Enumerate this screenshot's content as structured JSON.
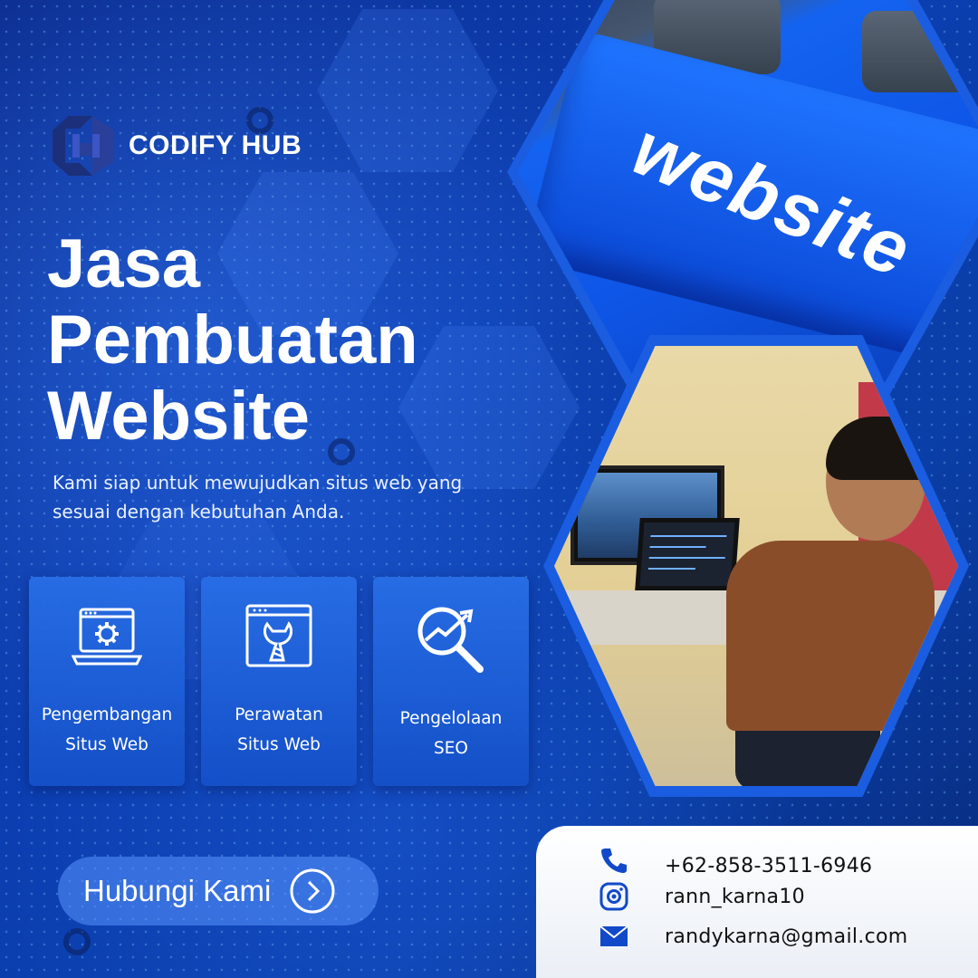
{
  "brand": {
    "name": "CODIFY HUB"
  },
  "headline": {
    "line1": "Jasa",
    "line2": "Pembuatan",
    "line3": "Website"
  },
  "subtitle": "Kami siap untuk mewujudkan situs web yang sesuai dengan kebutuhan Anda.",
  "services": [
    {
      "label": "Pengembangan\nSitus Web",
      "icon": "web-development-icon"
    },
    {
      "label": "Perawatan\nSitus Web",
      "icon": "website-maintenance-icon"
    },
    {
      "label": "Pengelolaan\nSEO",
      "icon": "seo-search-icon"
    }
  ],
  "cta": {
    "label": "Hubungi Kami",
    "icon": "chevron-right-circle-icon"
  },
  "photos": {
    "keyboard_key_text": "website"
  },
  "contact": {
    "phone": "+62-858-3511-6946",
    "instagram": "rann_karna10",
    "email": "randykarna@gmail.com"
  },
  "colors": {
    "background": "#0b3db0",
    "card": "#2a6ee6",
    "accent": "#1a5de0",
    "contact_icon": "#1149c9",
    "text": "#ffffff"
  }
}
